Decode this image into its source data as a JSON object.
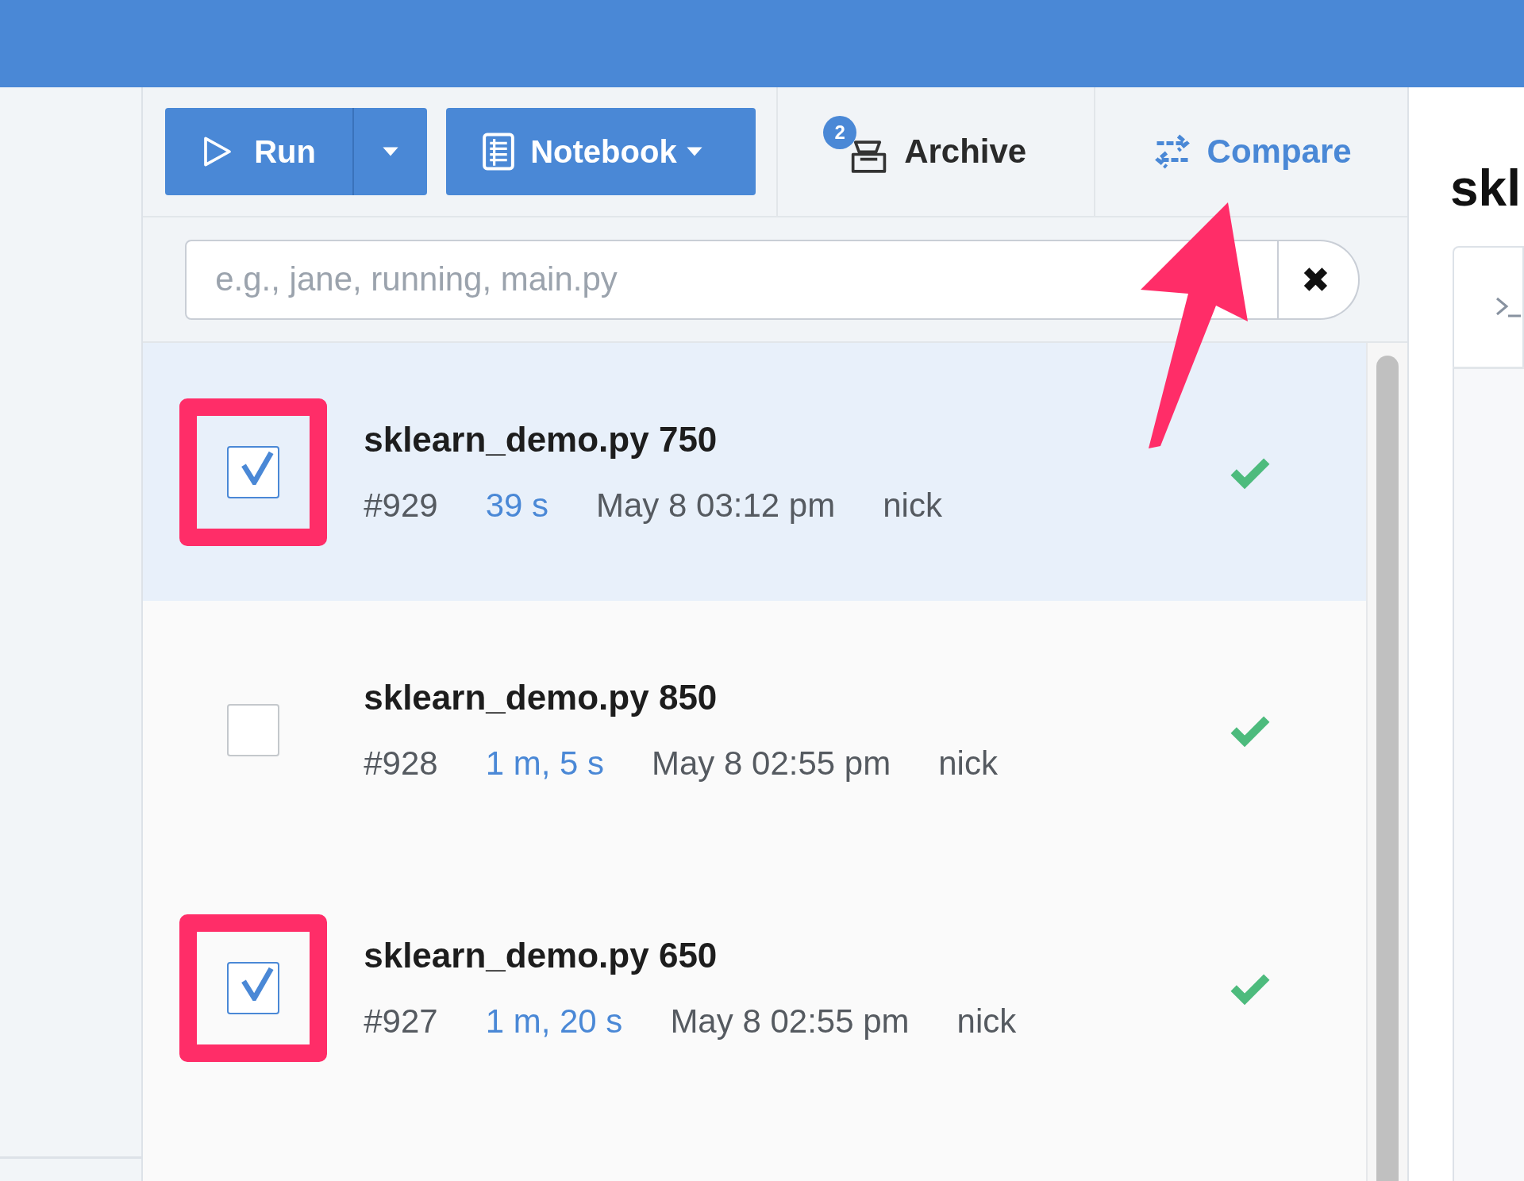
{
  "toolbar": {
    "run_button": {
      "label": "Run"
    },
    "notebook_button": {
      "label": "Notebook"
    },
    "archive": {
      "label": "Archive",
      "badge": "2"
    },
    "compare": {
      "label": "Compare"
    }
  },
  "search": {
    "placeholder": "e.g., jane, running, main.py",
    "clear_label": "✖"
  },
  "runs": [
    {
      "title": "sklearn_demo.py 750",
      "number": "#929",
      "duration": "39 s",
      "date": "May 8 03:12 pm",
      "user": "nick",
      "checked": true,
      "selected": true,
      "highlighted": true
    },
    {
      "title": "sklearn_demo.py 850",
      "number": "#928",
      "duration": "1 m, 5 s",
      "date": "May 8 02:55 pm",
      "user": "nick",
      "checked": false,
      "selected": false,
      "highlighted": false
    },
    {
      "title": "sklearn_demo.py 650",
      "number": "#927",
      "duration": "1 m, 20 s",
      "date": "May 8 02:55 pm",
      "user": "nick",
      "checked": true,
      "selected": false,
      "highlighted": true
    }
  ],
  "detail": {
    "title": "skl"
  },
  "callout_arrow": true
}
